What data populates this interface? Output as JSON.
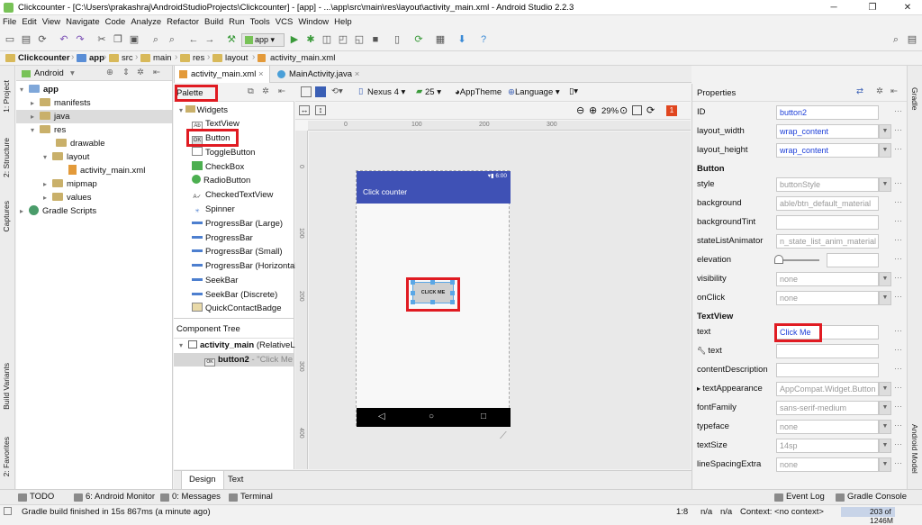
{
  "window": {
    "title": "Clickcounter - [C:\\Users\\prakashraj\\AndroidStudioProjects\\Clickcounter] - [app] - ...\\app\\src\\main\\res\\layout\\activity_main.xml - Android Studio 2.2.3",
    "minimize": "─",
    "maximize": "❐",
    "close": "✕"
  },
  "menu": [
    "File",
    "Edit",
    "View",
    "Navigate",
    "Code",
    "Analyze",
    "Refactor",
    "Build",
    "Run",
    "Tools",
    "VCS",
    "Window",
    "Help"
  ],
  "toolbar": {
    "run_config": "app"
  },
  "breadcrumbs": [
    "Clickcounter",
    "app",
    "src",
    "main",
    "res",
    "layout",
    "activity_main.xml"
  ],
  "left_strip": {
    "project": "1: Project",
    "structure": "2: Structure",
    "captures": "Captures",
    "build_variants": "Build Variants",
    "favorites": "2: Favorites"
  },
  "right_strip": {
    "gradle": "Gradle",
    "android_model": "Android Model"
  },
  "project": {
    "view": "Android",
    "tree": [
      "app",
      "manifests",
      "java",
      "res",
      "drawable",
      "layout",
      "activity_main.xml",
      "mipmap",
      "values",
      "Gradle Scripts"
    ]
  },
  "editor_tabs": [
    "activity_main.xml",
    "MainActivity.java"
  ],
  "palette": {
    "title": "Palette",
    "category": "Widgets",
    "items": [
      "TextView",
      "Button",
      "ToggleButton",
      "CheckBox",
      "RadioButton",
      "CheckedTextView",
      "Spinner",
      "ProgressBar (Large)",
      "ProgressBar",
      "ProgressBar (Small)",
      "ProgressBar (Horizontal)",
      "SeekBar",
      "SeekBar (Discrete)",
      "QuickContactBadge"
    ]
  },
  "component_tree": {
    "title": "Component Tree",
    "root": "activity_main",
    "root_type": "(RelativeLa",
    "child": "button2",
    "child_text": "- \"Click Me"
  },
  "design_toolbar": {
    "device": "Nexus 4",
    "api": "25",
    "theme": "AppTheme",
    "language": "Language",
    "zoom": "29%",
    "errors": "1"
  },
  "rulers": {
    "h": [
      "0",
      "100",
      "200",
      "300"
    ],
    "v": [
      "0",
      "100",
      "200",
      "300",
      "400"
    ]
  },
  "phone": {
    "status_time": "6:00",
    "app_title": "Click counter",
    "button_text": "CLICK ME"
  },
  "design_tabs": [
    "Design",
    "Text"
  ],
  "properties": {
    "title": "Properties",
    "rows": [
      {
        "label": "ID",
        "value": "button2",
        "style": "blue"
      },
      {
        "label": "layout_width",
        "value": "wrap_content",
        "style": "blue",
        "dd": true
      },
      {
        "label": "layout_height",
        "value": "wrap_content",
        "style": "blue",
        "dd": true
      },
      {
        "section": "Button"
      },
      {
        "label": "style",
        "value": "buttonStyle",
        "style": "gray",
        "dd": true
      },
      {
        "label": "background",
        "value": "able/btn_default_material",
        "style": "gray"
      },
      {
        "label": "backgroundTint",
        "value": "",
        "style": ""
      },
      {
        "label": "stateListAnimator",
        "value": "n_state_list_anim_material",
        "style": "gray"
      },
      {
        "label": "elevation",
        "value": "",
        "style": "slider"
      },
      {
        "label": "visibility",
        "value": "none",
        "style": "gray",
        "dd": true
      },
      {
        "label": "onClick",
        "value": "none",
        "style": "gray",
        "dd": true
      },
      {
        "section": "TextView"
      },
      {
        "label": "text",
        "value": "Click Me",
        "style": "blue"
      },
      {
        "label": "text",
        "value": "",
        "style": "",
        "wrench": true
      },
      {
        "label": "contentDescription",
        "value": "",
        "style": ""
      },
      {
        "label": "textAppearance",
        "value": "AppCompat.Widget.Button",
        "style": "gray",
        "dd": true,
        "expand": true
      },
      {
        "label": "fontFamily",
        "value": "sans-serif-medium",
        "style": "gray",
        "dd": true
      },
      {
        "label": "typeface",
        "value": "none",
        "style": "gray",
        "dd": true
      },
      {
        "label": "textSize",
        "value": "14sp",
        "style": "gray",
        "dd": true
      },
      {
        "label": "lineSpacingExtra",
        "value": "none",
        "style": "gray",
        "dd": true
      }
    ]
  },
  "bottom_tools": {
    "todo": "TODO",
    "monitor": "6: Android Monitor",
    "messages": "0: Messages",
    "terminal": "Terminal",
    "event_log": "Event Log",
    "gradle_console": "Gradle Console"
  },
  "status": {
    "message": "Gradle build finished in 15s 867ms (a minute ago)",
    "position": "1:8",
    "lf": "n/a",
    "encoding": "n/a",
    "context": "Context: <no context>",
    "memory": "203 of 1246M"
  }
}
